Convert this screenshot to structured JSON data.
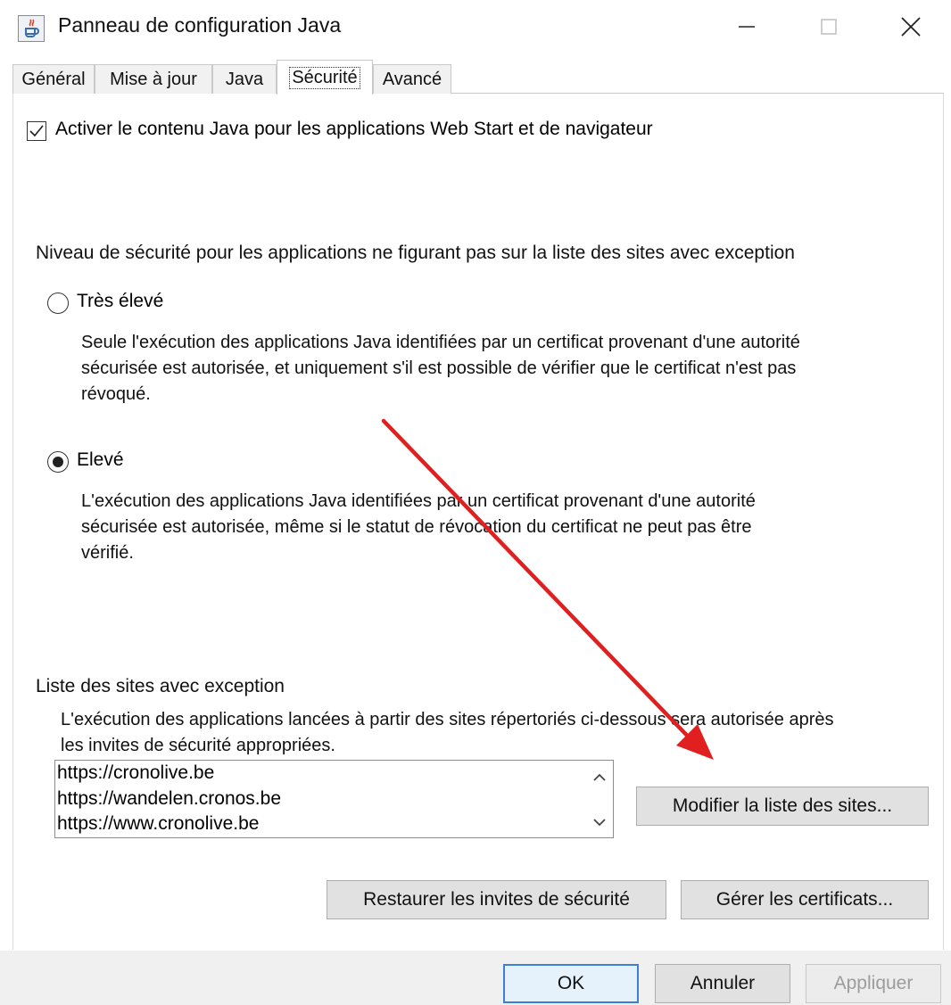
{
  "window": {
    "title": "Panneau de configuration Java",
    "icon": "java-control-panel-icon",
    "controls": [
      "minimize-icon",
      "maximize-icon",
      "close-icon"
    ]
  },
  "tabs": [
    {
      "label": "Général",
      "active": false
    },
    {
      "label": "Mise à jour",
      "active": false
    },
    {
      "label": "Java",
      "active": false
    },
    {
      "label": "Sécurité",
      "active": true
    },
    {
      "label": "Avancé",
      "active": false
    }
  ],
  "security": {
    "enable_java": {
      "label": "Activer le contenu Java pour les applications Web Start et de navigateur",
      "checked": true
    },
    "level_heading": "Niveau de sécurité pour les applications ne figurant pas sur la liste des sites avec exception",
    "levels": [
      {
        "label": "Très élevé",
        "selected": false,
        "description_lines": [
          "Seule l'exécution des applications Java identifiées par un certificat provenant d'une autorité",
          "sécurisée est autorisée, et uniquement s'il est possible de vérifier que le certificat n'est pas",
          "révoqué."
        ]
      },
      {
        "label": "Elevé",
        "selected": true,
        "description_lines": [
          "L'exécution des applications Java identifiées par un certificat provenant d'une autorité",
          "sécurisée est autorisée, même si le statut de révocation du certificat ne peut pas être",
          "vérifié."
        ]
      }
    ],
    "exception_heading": "Liste des sites avec exception",
    "exception_description_lines": [
      "L'exécution des applications lancées à partir des sites répertoriés ci-dessous sera autorisée après",
      "les invites de sécurité appropriées."
    ],
    "sites": [
      "https://cronolive.be",
      "https://wandelen.cronos.be",
      "https://www.cronolive.be"
    ],
    "edit_sites_button": "Modifier la liste des sites...",
    "restore_prompts_button": "Restaurer les invites de sécurité",
    "manage_certs_button": "Gérer les certificats..."
  },
  "footer": {
    "ok": "OK",
    "cancel": "Annuler",
    "apply": "Appliquer",
    "apply_enabled": false
  },
  "colors": {
    "annotation_arrow": "#e02020",
    "primary_button_border": "#3c7fd6"
  }
}
